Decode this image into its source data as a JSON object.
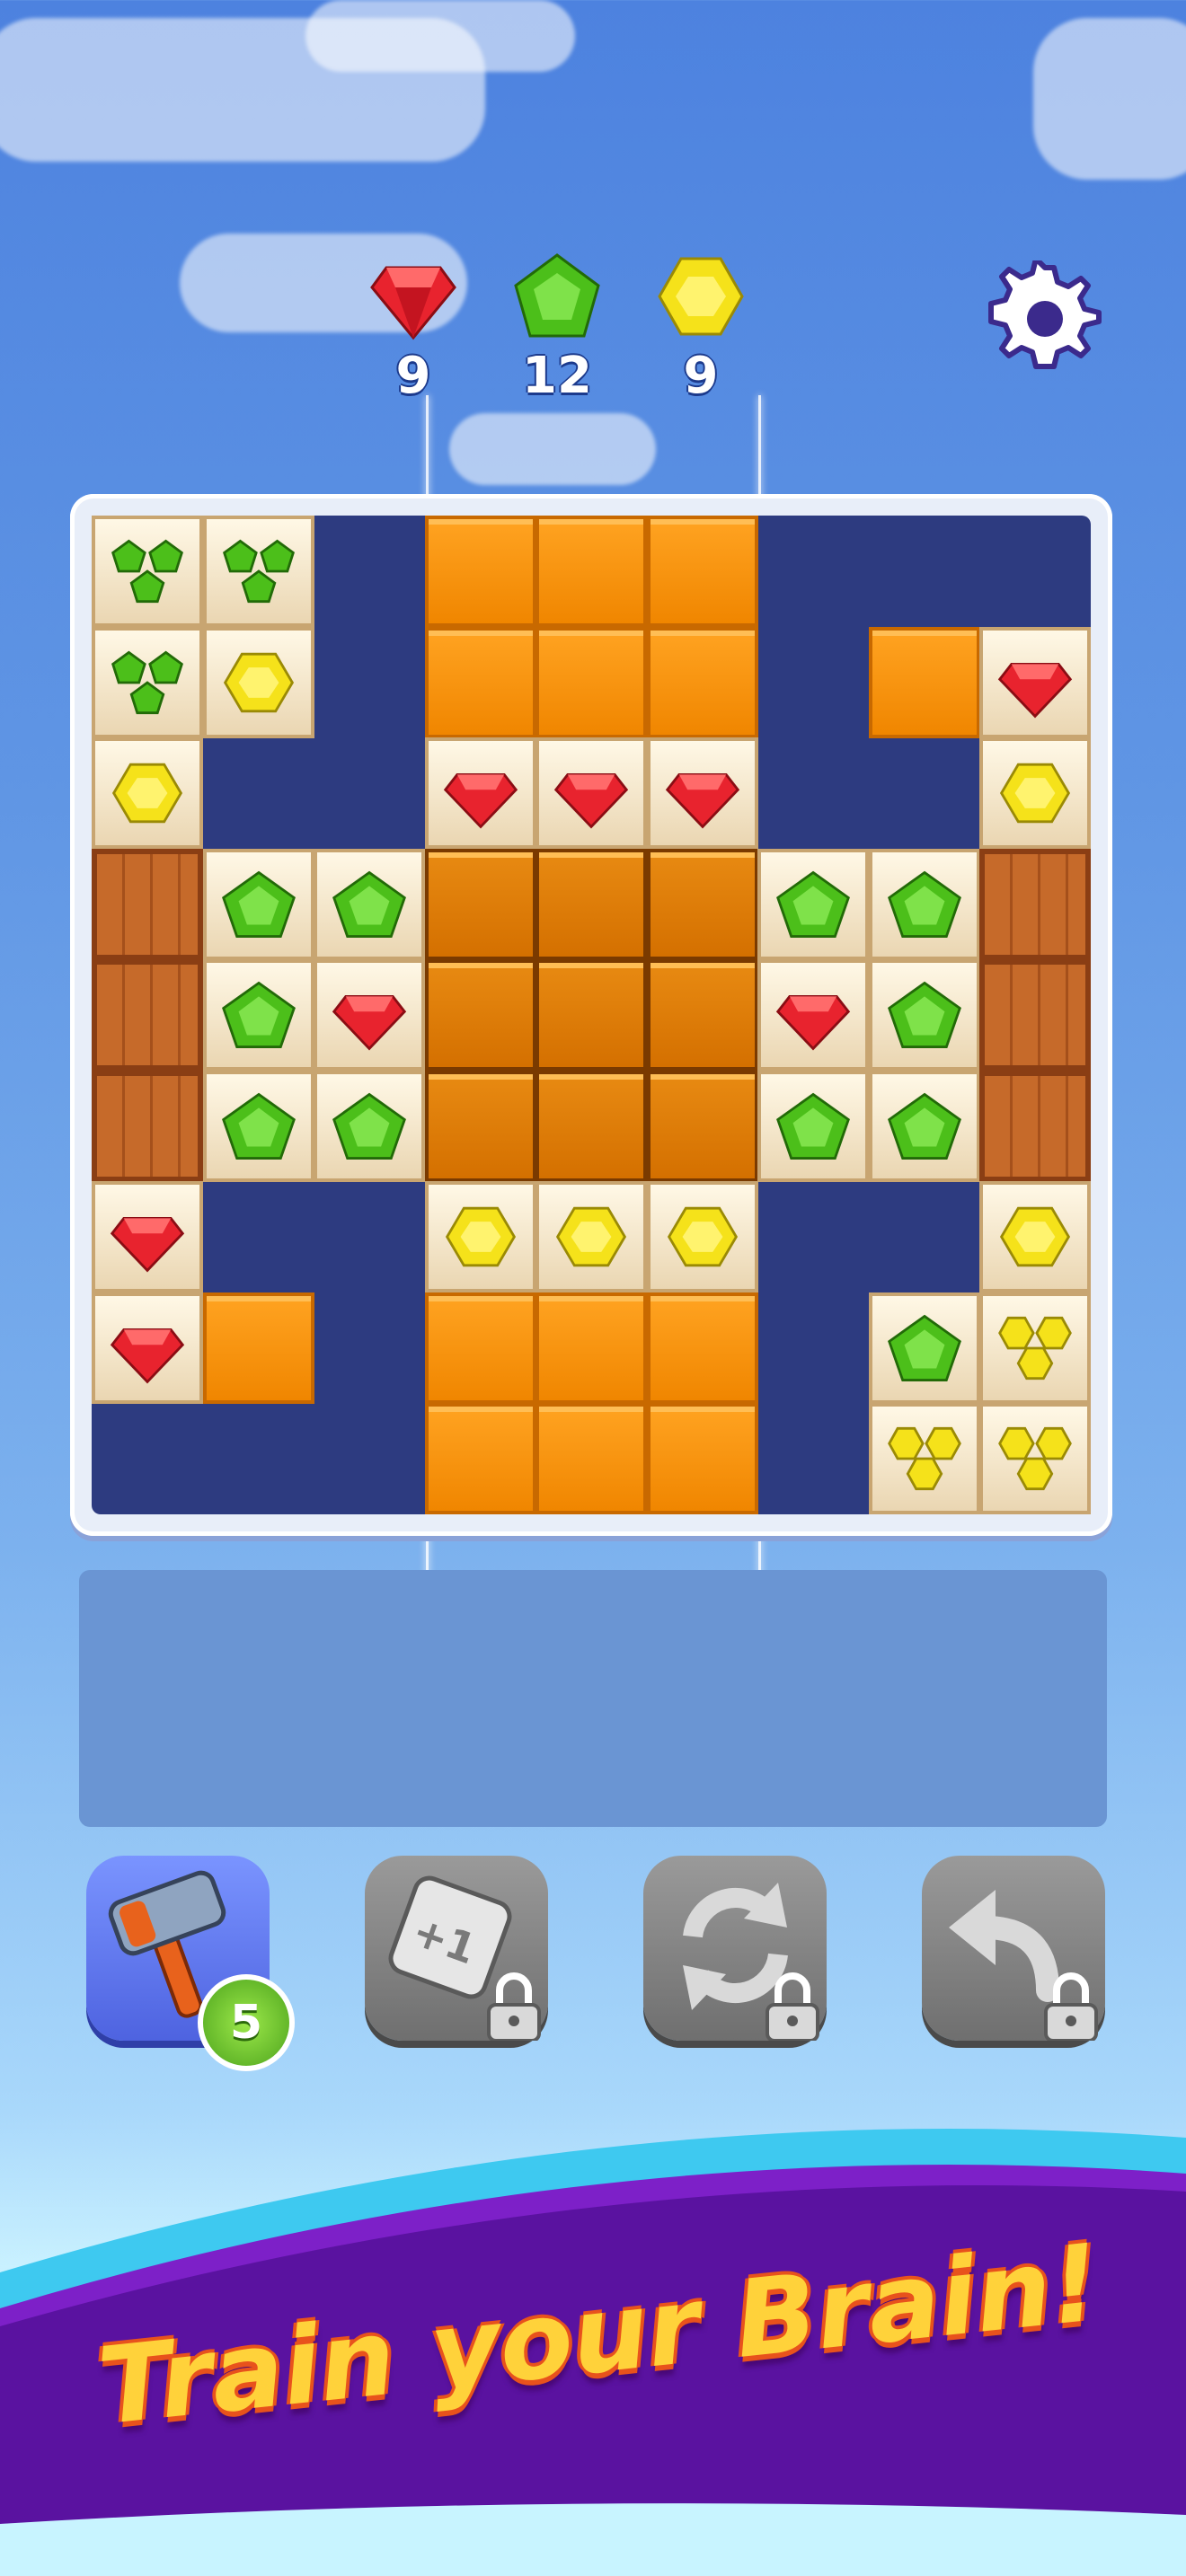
{
  "goals": [
    {
      "gem": "red-gem",
      "count": "9",
      "color": "#e8232e"
    },
    {
      "gem": "green-gem",
      "count": "12",
      "color": "#4cbf1a"
    },
    {
      "gem": "yellow-gem",
      "count": "9",
      "color": "#f5e21a"
    }
  ],
  "settings": {
    "icon": "gear-icon"
  },
  "board": {
    "size": 9,
    "legend": {
      "E": "empty",
      "O": "orange-block",
      "C": "center-orange-block",
      "R": "red-gem",
      "G": "green-gem",
      "Y": "yellow-gem",
      "K": "crate",
      "G3": "green-gem-cluster",
      "Y3": "yellow-gem-cluster"
    },
    "rows": [
      [
        "G3",
        "G3",
        "E",
        "O",
        "O",
        "O",
        "E",
        "E",
        "E"
      ],
      [
        "G3",
        "Y",
        "E",
        "O",
        "O",
        "O",
        "E",
        "O",
        "R"
      ],
      [
        "Y",
        "E",
        "E",
        "R",
        "R",
        "R",
        "E",
        "E",
        "Y"
      ],
      [
        "K",
        "G",
        "G",
        "C",
        "C",
        "C",
        "G",
        "G",
        "K"
      ],
      [
        "K",
        "G",
        "R",
        "C",
        "C",
        "C",
        "R",
        "G",
        "K"
      ],
      [
        "K",
        "G",
        "G",
        "C",
        "C",
        "C",
        "G",
        "G",
        "K"
      ],
      [
        "R",
        "E",
        "E",
        "Y",
        "Y",
        "Y",
        "E",
        "E",
        "Y"
      ],
      [
        "R",
        "O",
        "E",
        "O",
        "O",
        "O",
        "E",
        "G",
        "Y3"
      ],
      [
        "E",
        "E",
        "E",
        "O",
        "O",
        "O",
        "E",
        "Y3",
        "Y3"
      ]
    ]
  },
  "boosters": [
    {
      "name": "hammer",
      "icon": "hammer-icon",
      "count": "5",
      "locked": false
    },
    {
      "name": "plus-one-tile",
      "icon": "plus-one-tile-icon",
      "label": "+1",
      "locked": true
    },
    {
      "name": "shuffle",
      "icon": "shuffle-icon",
      "locked": true
    },
    {
      "name": "undo",
      "icon": "undo-icon",
      "locked": true
    }
  ],
  "banner": {
    "slogan": "Train your Brain!"
  }
}
